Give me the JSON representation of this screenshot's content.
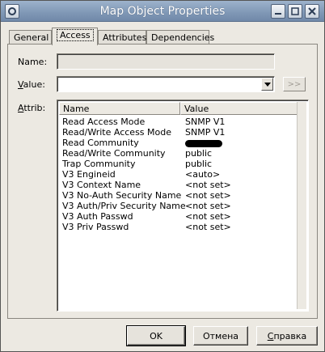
{
  "window": {
    "title": "Map Object Properties"
  },
  "tabs": [
    {
      "label": "General"
    },
    {
      "label": "Access"
    },
    {
      "label": "Attributes"
    },
    {
      "label": "Dependencies"
    }
  ],
  "form": {
    "name_label": "Name:",
    "name_value": "",
    "value_label_first": "V",
    "value_label_rest": "alue:",
    "value_value": "",
    "set_button": ">>",
    "attrib_label_first": "A",
    "attrib_label_rest": "ttrib:"
  },
  "attrib_table": {
    "columns": [
      "Name",
      "Value"
    ],
    "rows": [
      {
        "name": "Read Access Mode",
        "value": "SNMP V1"
      },
      {
        "name": "Read/Write Access Mode",
        "value": "SNMP V1"
      },
      {
        "name": "Read Community",
        "value": "",
        "redacted": true
      },
      {
        "name": "Read/Write Community",
        "value": "public"
      },
      {
        "name": "Trap Community",
        "value": "public"
      },
      {
        "name": "V3 Engineid",
        "value": "<auto>"
      },
      {
        "name": "V3 Context Name",
        "value": "<not set>"
      },
      {
        "name": "V3 No-Auth Security Name",
        "value": "<not set>"
      },
      {
        "name": "V3 Auth/Priv Security Name",
        "value": "<not set>"
      },
      {
        "name": "V3 Auth Passwd",
        "value": "<not set>"
      },
      {
        "name": "V3 Priv Passwd",
        "value": "<not set>"
      }
    ]
  },
  "buttons": {
    "ok": "OK",
    "cancel": "Отмена",
    "help_first": "С",
    "help_rest": "правка"
  },
  "icons": {
    "system_menu": "window-menu-icon",
    "minimize": "minimize-icon",
    "maximize": "maximize-icon",
    "close": "close-icon",
    "dropdown": "chevron-down-icon"
  }
}
